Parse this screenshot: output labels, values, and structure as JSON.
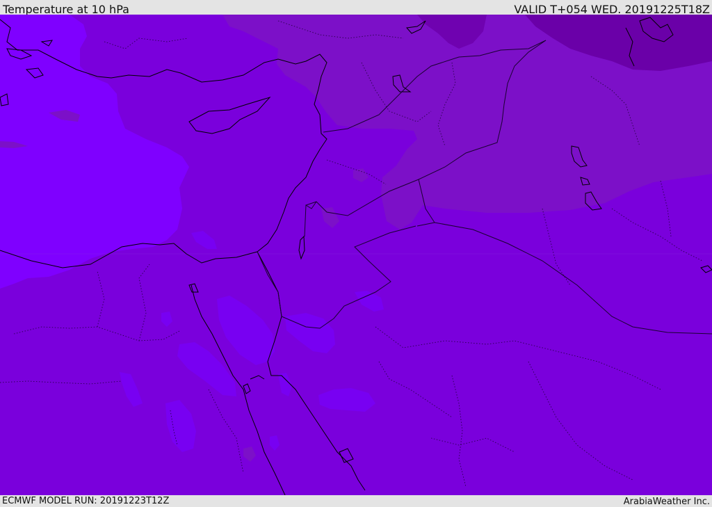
{
  "header": {
    "title": "Temperature at 10 hPa",
    "valid_time": "VALID T+054 WED. 20191225T18Z"
  },
  "footer": {
    "model_run": "ECMWF MODEL RUN: 20191223T12Z",
    "credit": "ArabiaWeather Inc."
  },
  "map": {
    "variable": "temperature",
    "pressure_level_hpa": 10,
    "palette": {
      "base": "#7a00dc",
      "warm": "#7800f2",
      "warmer": "#7f00ff",
      "cool": "#7c10c8",
      "cooler": "#7806b8",
      "coldest": "#6a00a8",
      "border": "#1a0030",
      "coast": "#000000"
    }
  }
}
